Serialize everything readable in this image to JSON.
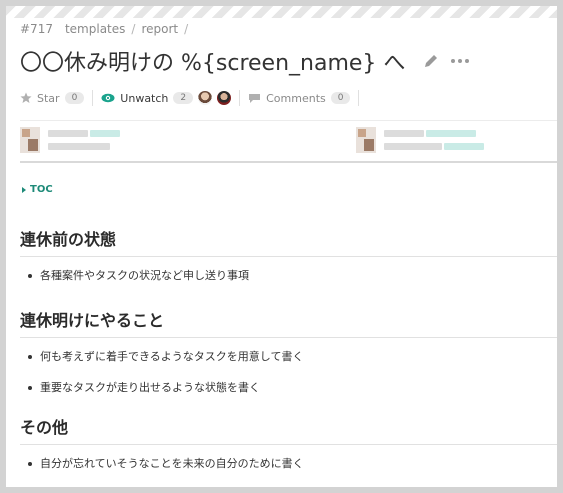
{
  "breadcrumb": {
    "number": "#717",
    "items": [
      "templates",
      "report"
    ],
    "separator": "/"
  },
  "title": "〇〇休み明けの %{screen_name} へ",
  "icons": {
    "edit": "pencil-icon",
    "more": "ellipsis-icon",
    "star": "star-icon",
    "watch": "eye-icon",
    "comments": "comment-icon",
    "toc": "triangle-right-icon"
  },
  "actions": {
    "star_label": "Star",
    "star_count": "0",
    "watch_label": "Unwatch",
    "watch_count": "2",
    "comments_label": "Comments",
    "comments_count": "0"
  },
  "toc_label": "TOC",
  "sections": [
    {
      "heading": "連休前の状態",
      "items": [
        "各種案件やタスクの状況など申し送り事項"
      ]
    },
    {
      "heading": "連休明けにやること",
      "items": [
        "何も考えずに着手できるようなタスクを用意して書く",
        "重要なタスクが走り出せるような状態を書く"
      ]
    },
    {
      "heading": "その他",
      "items": [
        "自分が忘れていそうなことを未来の自分のために書く"
      ]
    }
  ],
  "colors": {
    "accent": "#1d8a78",
    "watch_icon": "#1aa38d"
  }
}
